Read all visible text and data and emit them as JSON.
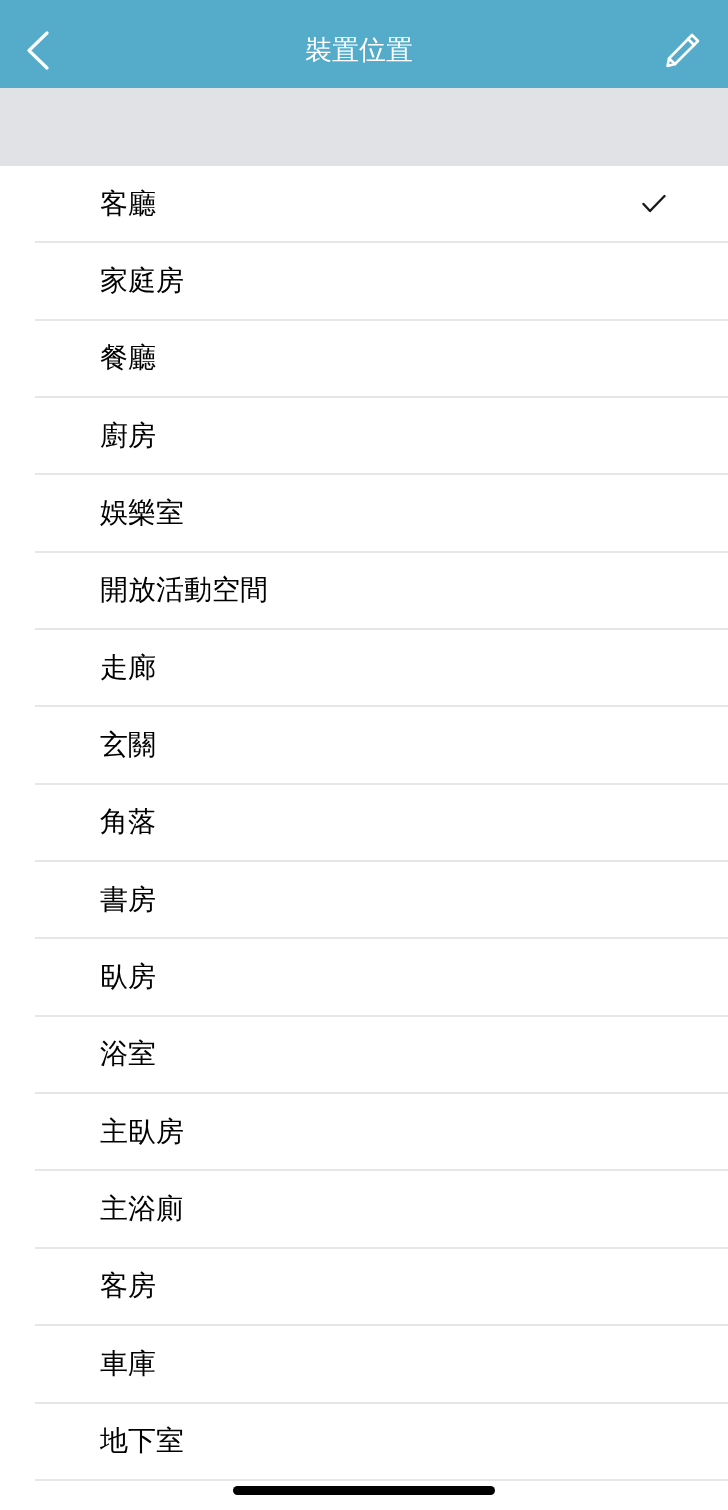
{
  "nav_bar": {
    "title": "裝置位置"
  },
  "locations": [
    {
      "label": "客廳",
      "selected": true
    },
    {
      "label": "家庭房",
      "selected": false
    },
    {
      "label": "餐廳",
      "selected": false
    },
    {
      "label": "廚房",
      "selected": false
    },
    {
      "label": "娛樂室",
      "selected": false
    },
    {
      "label": "開放活動空間",
      "selected": false
    },
    {
      "label": "走廊",
      "selected": false
    },
    {
      "label": "玄關",
      "selected": false
    },
    {
      "label": "角落",
      "selected": false
    },
    {
      "label": "書房",
      "selected": false
    },
    {
      "label": "臥房",
      "selected": false
    },
    {
      "label": "浴室",
      "selected": false
    },
    {
      "label": "主臥房",
      "selected": false
    },
    {
      "label": "主浴廁",
      "selected": false
    },
    {
      "label": "客房",
      "selected": false
    },
    {
      "label": "車庫",
      "selected": false
    },
    {
      "label": "地下室",
      "selected": false
    }
  ]
}
